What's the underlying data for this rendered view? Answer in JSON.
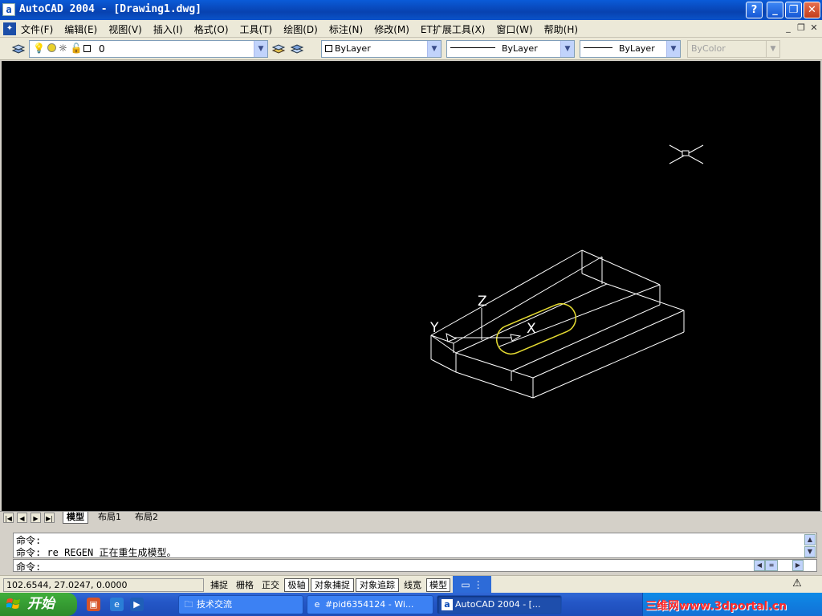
{
  "window": {
    "title": "AutoCAD 2004 - [Drawing1.dwg]",
    "app_icon": "a",
    "help": "?",
    "minimize": "_",
    "restore": "❐",
    "close": "✕"
  },
  "menu": {
    "items": [
      "文件(F)",
      "编辑(E)",
      "视图(V)",
      "插入(I)",
      "格式(O)",
      "工具(T)",
      "绘图(D)",
      "标注(N)",
      "修改(M)",
      "ET扩展工具(X)",
      "窗口(W)",
      "帮助(H)"
    ],
    "doc_minimize": "_",
    "doc_restore": "❐",
    "doc_close": "✕"
  },
  "properties_toolbar": {
    "layer_value": "0",
    "color_value": "ByLayer",
    "linetype_value": "ByLayer",
    "lineweight_value": "ByLayer",
    "plotstyle_value": "ByColor"
  },
  "ucs_icon": {
    "x_label": "X",
    "y_label": "Y",
    "z_label": "Z"
  },
  "model_colors": {
    "background": "#000000",
    "wireframe": "#ffffff",
    "slot": "#e6dc32"
  },
  "layout_tabs": {
    "nav": [
      "|◀",
      "◀",
      "▶",
      "▶|"
    ],
    "tabs": [
      "模型",
      "布局1",
      "布局2"
    ],
    "active": "模型"
  },
  "command": {
    "history": [
      "命令:",
      "命令: re REGEN 正在重生成模型。"
    ],
    "prompt": "命令:"
  },
  "status": {
    "coords": "102.6544, 27.0247, 0.0000",
    "toggles": [
      {
        "label": "捕捉",
        "on": false
      },
      {
        "label": "栅格",
        "on": false
      },
      {
        "label": "正交",
        "on": false
      },
      {
        "label": "极轴",
        "on": true
      },
      {
        "label": "对象捕捉",
        "on": true
      },
      {
        "label": "对象追踪",
        "on": true
      },
      {
        "label": "线宽",
        "on": false
      },
      {
        "label": "模型",
        "on": true
      }
    ]
  },
  "taskbar": {
    "start_label": "开始",
    "tasks": [
      {
        "label": "技术交流",
        "icon": "folder-icon",
        "active": false
      },
      {
        "label": "#pid6354124 - Wi...",
        "icon": "ie-icon",
        "active": false
      },
      {
        "label": "AutoCAD 2004 - [...",
        "icon": "autocad-icon",
        "active": true
      }
    ],
    "watermark": "三维网www.3dportal.cn"
  }
}
